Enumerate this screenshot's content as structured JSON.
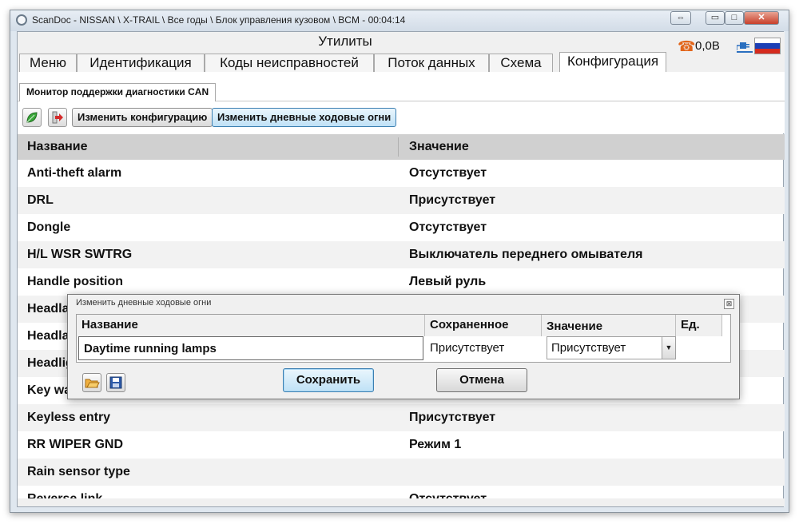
{
  "window": {
    "title": "ScanDoc - NISSAN \\ X-TRAIL \\ Все годы \\ Блок управления кузовом \\ BCM - 00:04:14",
    "controls": {
      "restore": "⇔",
      "minimize": "▭",
      "maximize": "□",
      "close": "✕"
    }
  },
  "header": {
    "utility_title": "Утилиты",
    "voltage": "0,0В",
    "phone_icon": "☎"
  },
  "tabs": [
    {
      "label": "Меню"
    },
    {
      "label": "Идентификация"
    },
    {
      "label": "Коды неисправностей"
    },
    {
      "label": "Поток данных"
    },
    {
      "label": "Схема"
    },
    {
      "label": "Конфигурация",
      "active": true
    }
  ],
  "subtab": {
    "label": "Монитор поддержки диагностики CAN"
  },
  "toolbar": {
    "change_config": "Изменить конфигурацию",
    "change_drl": "Изменить дневные ходовые огни"
  },
  "table": {
    "col_name": "Название",
    "col_value": "Значение",
    "rows": [
      {
        "name": "Anti-theft alarm",
        "value": "Отсутствует"
      },
      {
        "name": "DRL",
        "value": "Присутствует"
      },
      {
        "name": "Dongle",
        "value": "Отсутствует"
      },
      {
        "name": "H/L WSR SWTRG",
        "value": "Выключатель переднего омывателя"
      },
      {
        "name": "Handle position",
        "value": "Левый руль"
      },
      {
        "name": "Headla",
        "value": ""
      },
      {
        "name": "Headla",
        "value": ""
      },
      {
        "name": "Headlig",
        "value": ""
      },
      {
        "name": "Key wa",
        "value": ""
      },
      {
        "name": "Keyless entry",
        "value": "Присутствует"
      },
      {
        "name": "RR WIPER GND",
        "value": "Режим 1"
      },
      {
        "name": "Rain sensor type",
        "value": ""
      },
      {
        "name": "Reverse link",
        "value": "Отсутствует"
      }
    ]
  },
  "dialog": {
    "title": "Изменить дневные ходовые огни",
    "close": "⊠",
    "columns": {
      "name": "Название",
      "saved": "Сохраненное",
      "value": "Значение",
      "unit": "Ед."
    },
    "row": {
      "name": "Daytime running lamps",
      "saved": "Присутствует",
      "value": "Присутствует",
      "unit": ""
    },
    "save": "Сохранить",
    "cancel": "Отмена"
  }
}
